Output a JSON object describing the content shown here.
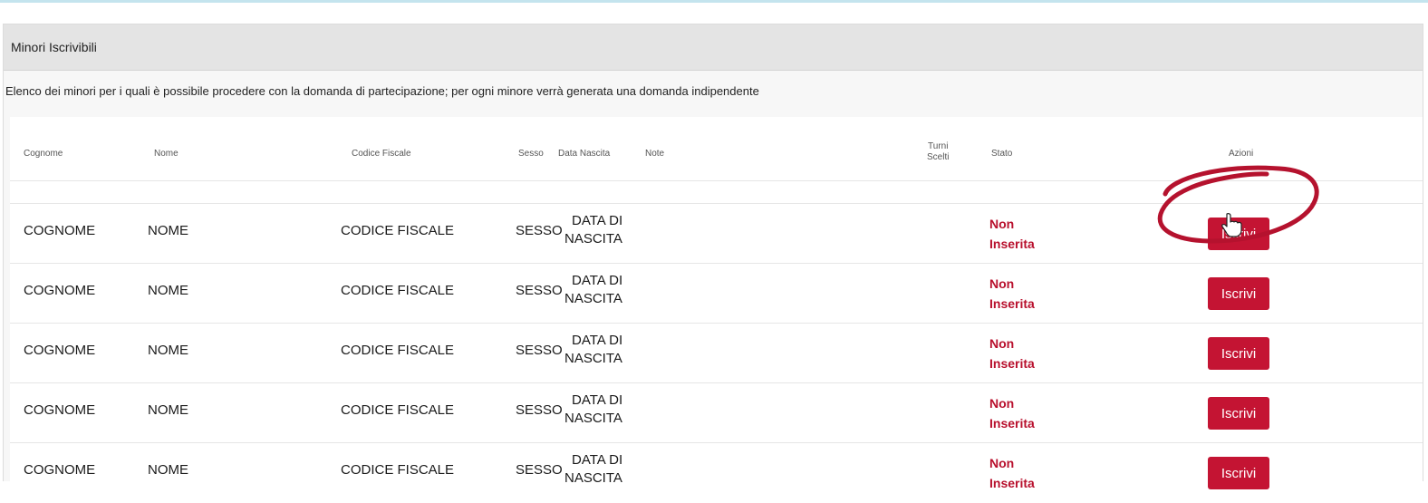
{
  "panel": {
    "title": "Minori Iscrivibili",
    "description": "Elenco dei minori per i quali è possibile procedere con la domanda di partecipazione; per ogni minore verrà generata una domanda indipendente"
  },
  "table": {
    "headers": {
      "cognome": "Cognome",
      "nome": "Nome",
      "codice_fiscale": "Codice Fiscale",
      "sesso": "Sesso",
      "data_nascita": "Data Nascita",
      "note": "Note",
      "turni_scelti_1": "Turni",
      "turni_scelti_2": "Scelti",
      "stato": "Stato",
      "azioni": "Azioni"
    },
    "rows": [
      {
        "cognome": "COGNOME",
        "nome": "NOME",
        "codice_fiscale": "CODICE FISCALE",
        "sesso": "SESSO",
        "dob_1": "DATA DI",
        "dob_2": "NASCITA",
        "note": "",
        "stato_1": "Non",
        "stato_2": "Inserita",
        "action": "Iscrivi"
      },
      {
        "cognome": "COGNOME",
        "nome": "NOME",
        "codice_fiscale": "CODICE FISCALE",
        "sesso": "SESSO",
        "dob_1": "DATA DI",
        "dob_2": "NASCITA",
        "note": "",
        "stato_1": "Non",
        "stato_2": "Inserita",
        "action": "Iscrivi"
      },
      {
        "cognome": "COGNOME",
        "nome": "NOME",
        "codice_fiscale": "CODICE FISCALE",
        "sesso": "SESSO",
        "dob_1": "DATA DI",
        "dob_2": "NASCITA",
        "note": "",
        "stato_1": "Non",
        "stato_2": "Inserita",
        "action": "Iscrivi"
      },
      {
        "cognome": "COGNOME",
        "nome": "NOME",
        "codice_fiscale": "CODICE FISCALE",
        "sesso": "SESSO",
        "dob_1": "DATA DI",
        "dob_2": "NASCITA",
        "note": "",
        "stato_1": "Non",
        "stato_2": "Inserita",
        "action": "Iscrivi"
      },
      {
        "cognome": "COGNOME",
        "nome": "NOME",
        "codice_fiscale": "CODICE FISCALE",
        "sesso": "SESSO",
        "dob_1": "DATA DI",
        "dob_2": "NASCITA",
        "note": "",
        "stato_1": "Non",
        "stato_2": "Inserita",
        "action": "Iscrivi"
      }
    ]
  },
  "colors": {
    "accent": "#c41433",
    "status_text": "#b8102d",
    "annotation": "#b5122e"
  },
  "annotation": {
    "highlight_icon": "highlight-ellipse",
    "cursor_icon": "hand-pointer-icon"
  }
}
